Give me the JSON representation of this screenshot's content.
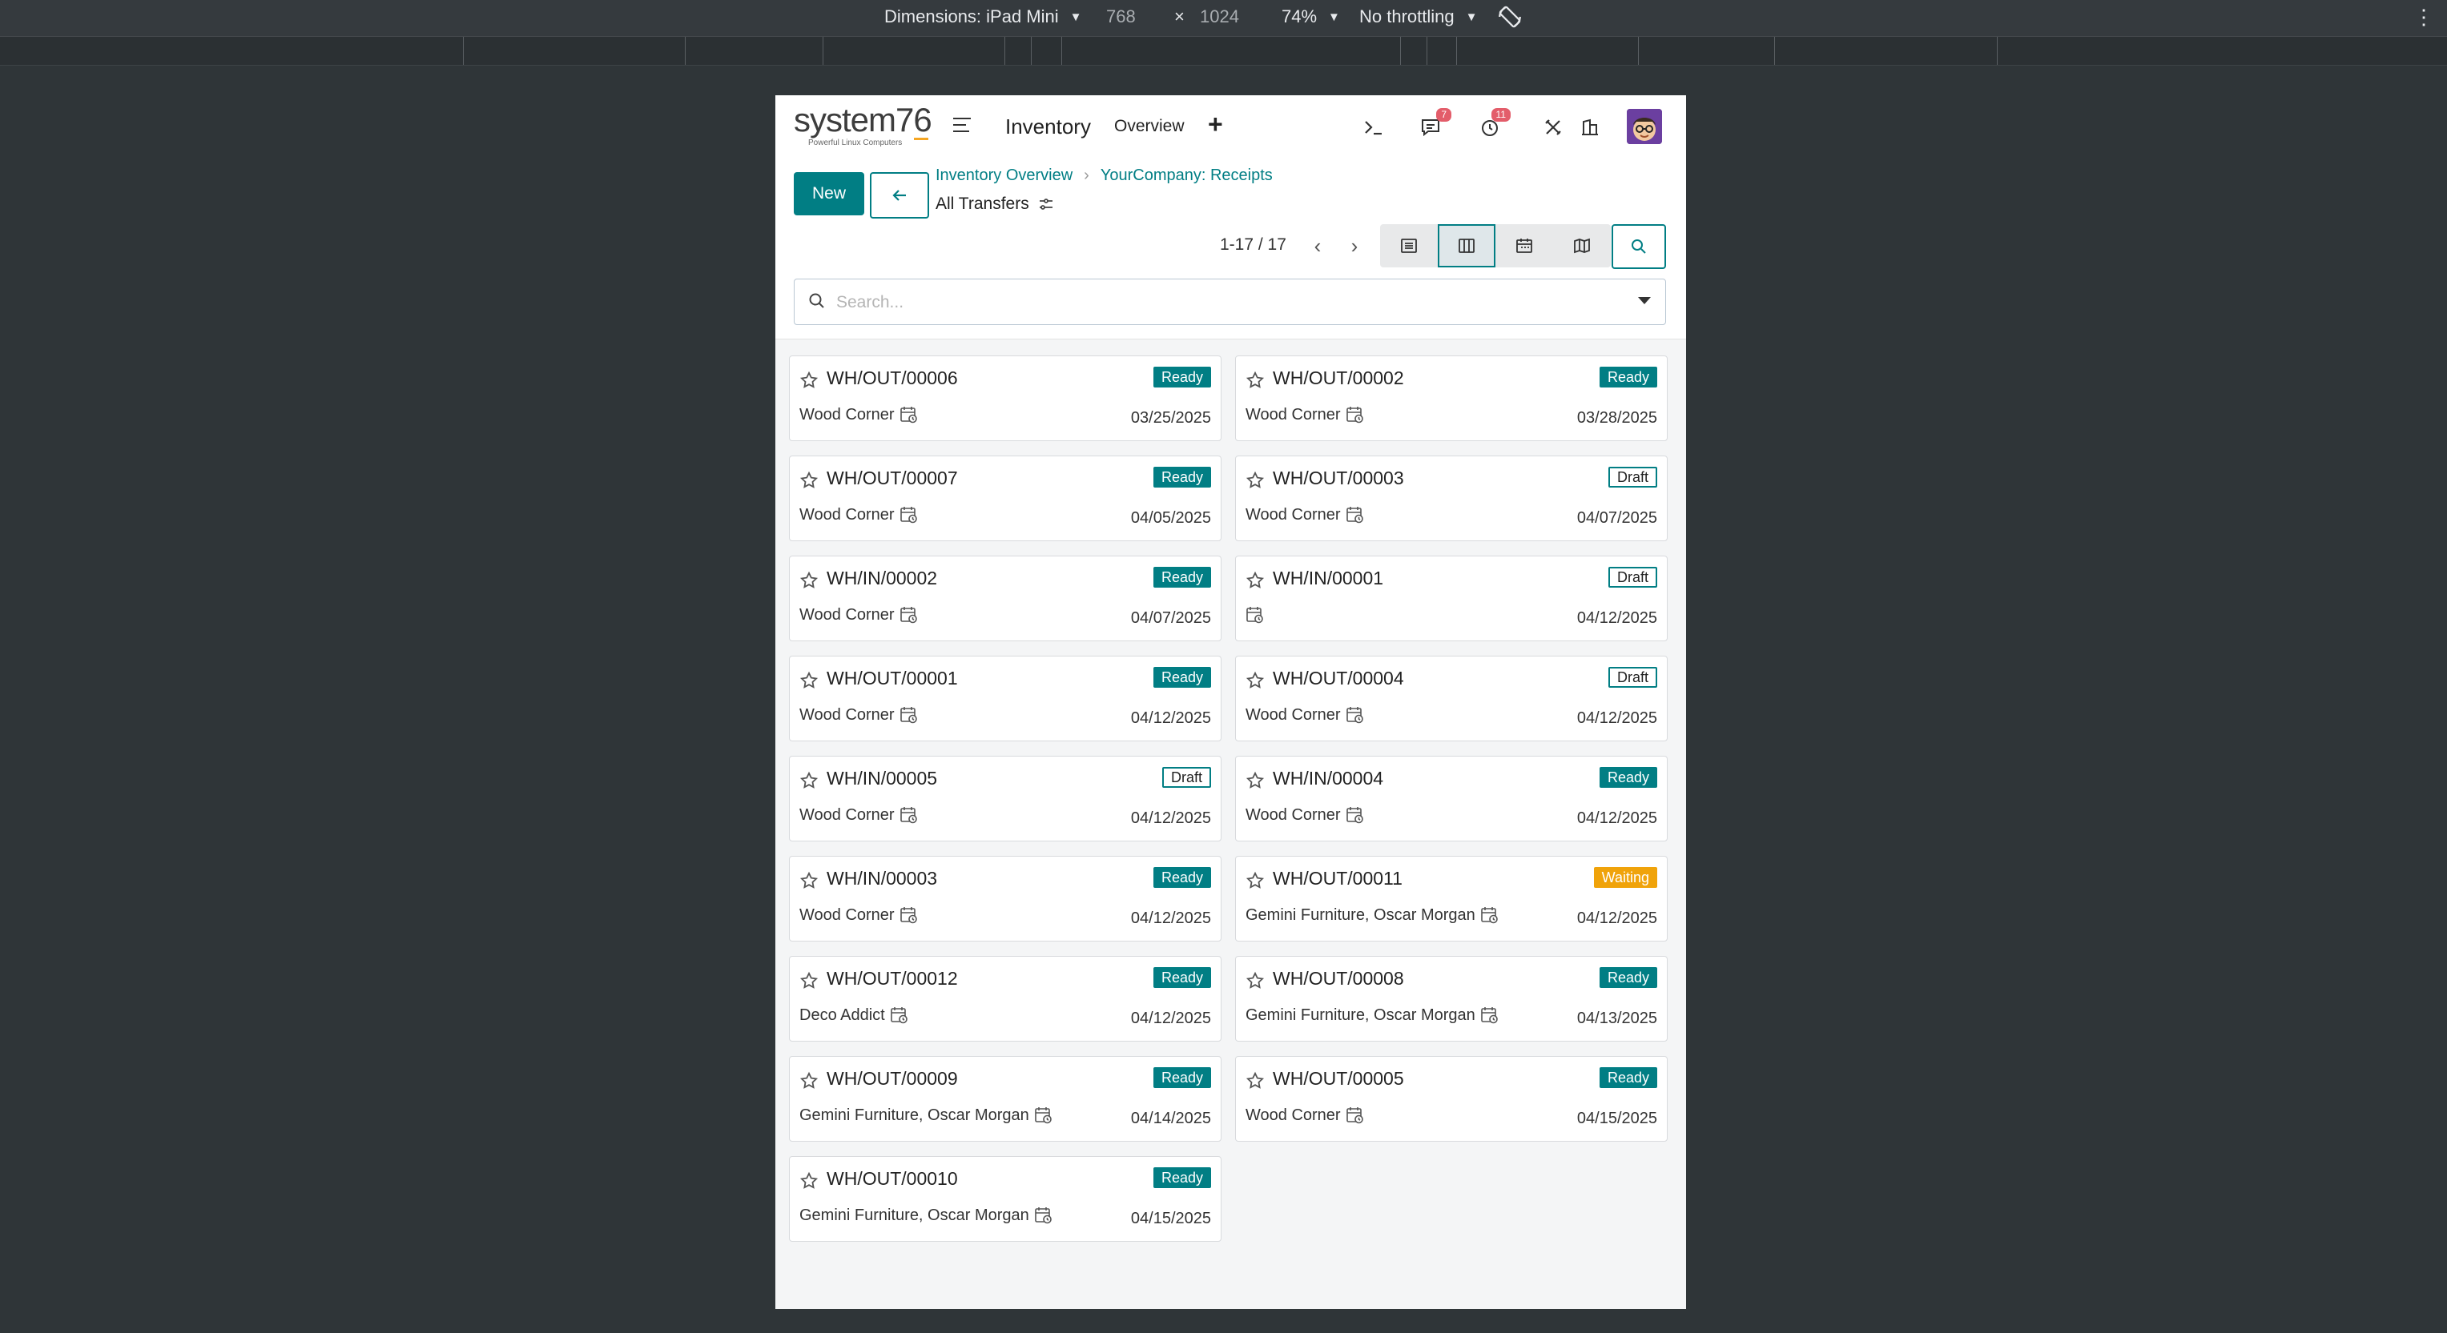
{
  "devtools": {
    "dimensions_label": "Dimensions: iPad Mini",
    "width": "768",
    "times": "×",
    "height": "1024",
    "zoom": "74%",
    "throttling": "No throttling"
  },
  "topnav": {
    "logo_text": "system76",
    "logo_tagline": "Powerful Linux Computers",
    "app_name": "Inventory",
    "overview": "Overview",
    "plus": "+",
    "messages_count": "7",
    "activities_count": "11"
  },
  "control": {
    "new_label": "New",
    "breadcrumb": [
      "Inventory Overview",
      "YourCompany: Receipts"
    ],
    "current_view": "All Transfers",
    "pager": "1-17 / 17",
    "search_placeholder": "Search..."
  },
  "icons": {
    "menu": "hamburger-icon",
    "back": "arrow-left-icon",
    "settings": "gear-icon",
    "terminal": "terminal-icon",
    "chat": "chat-icon",
    "clock": "activity-clock-icon",
    "tools": "tools-icon",
    "company": "building-icon",
    "star": "star-icon",
    "calendar": "calendar-clock-icon",
    "search": "search-icon"
  },
  "colors": {
    "primary": "#017e84",
    "waiting": "#f0a30a",
    "badge": "#e35d6a"
  },
  "cards": [
    {
      "ref": "WH/OUT/00006",
      "partner": "Wood Corner",
      "status": "Ready",
      "date": "03/25/2025"
    },
    {
      "ref": "WH/OUT/00002",
      "partner": "Wood Corner",
      "status": "Ready",
      "date": "03/28/2025"
    },
    {
      "ref": "WH/OUT/00007",
      "partner": "Wood Corner",
      "status": "Ready",
      "date": "04/05/2025"
    },
    {
      "ref": "WH/OUT/00003",
      "partner": "Wood Corner",
      "status": "Draft",
      "date": "04/07/2025"
    },
    {
      "ref": "WH/IN/00002",
      "partner": "Wood Corner",
      "status": "Ready",
      "date": "04/07/2025"
    },
    {
      "ref": "WH/IN/00001",
      "partner": "",
      "status": "Draft",
      "date": "04/12/2025"
    },
    {
      "ref": "WH/OUT/00001",
      "partner": "Wood Corner",
      "status": "Ready",
      "date": "04/12/2025"
    },
    {
      "ref": "WH/OUT/00004",
      "partner": "Wood Corner",
      "status": "Draft",
      "date": "04/12/2025"
    },
    {
      "ref": "WH/IN/00005",
      "partner": "Wood Corner",
      "status": "Draft",
      "date": "04/12/2025"
    },
    {
      "ref": "WH/IN/00004",
      "partner": "Wood Corner",
      "status": "Ready",
      "date": "04/12/2025"
    },
    {
      "ref": "WH/IN/00003",
      "partner": "Wood Corner",
      "status": "Ready",
      "date": "04/12/2025"
    },
    {
      "ref": "WH/OUT/00011",
      "partner": "Gemini Furniture, Oscar Morgan",
      "status": "Waiting",
      "date": "04/12/2025"
    },
    {
      "ref": "WH/OUT/00012",
      "partner": "Deco Addict",
      "status": "Ready",
      "date": "04/12/2025"
    },
    {
      "ref": "WH/OUT/00008",
      "partner": "Gemini Furniture, Oscar Morgan",
      "status": "Ready",
      "date": "04/13/2025"
    },
    {
      "ref": "WH/OUT/00009",
      "partner": "Gemini Furniture, Oscar Morgan",
      "status": "Ready",
      "date": "04/14/2025"
    },
    {
      "ref": "WH/OUT/00005",
      "partner": "Wood Corner",
      "status": "Ready",
      "date": "04/15/2025"
    },
    {
      "ref": "WH/OUT/00010",
      "partner": "Gemini Furniture, Oscar Morgan",
      "status": "Ready",
      "date": "04/15/2025"
    }
  ]
}
